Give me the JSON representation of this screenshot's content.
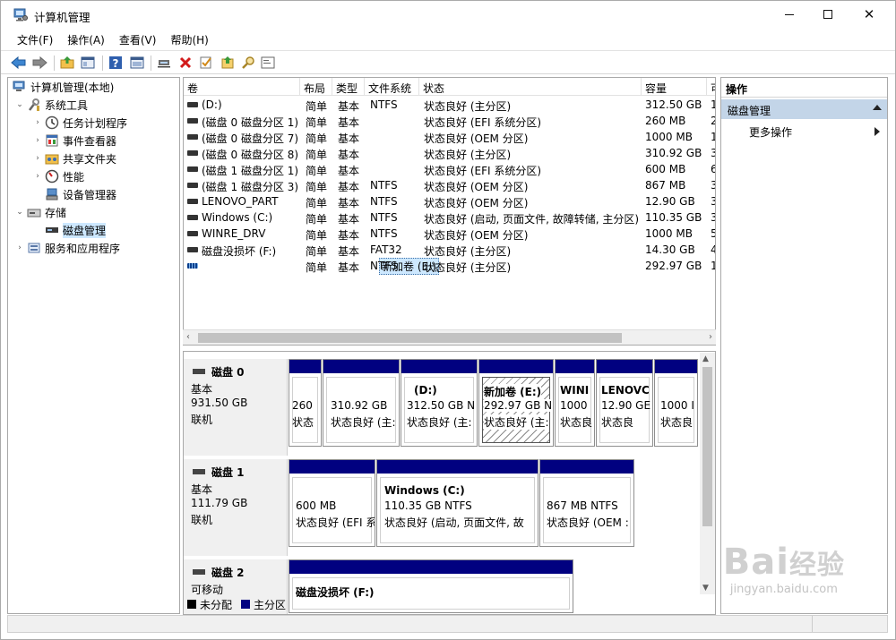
{
  "window": {
    "title": "计算机管理",
    "controls": {
      "min": "—",
      "max": "☐",
      "close": "✕"
    }
  },
  "menu": [
    "文件(F)",
    "操作(A)",
    "查看(V)",
    "帮助(H)"
  ],
  "toolbar": [
    "back-icon",
    "forward-icon",
    "up-folder-icon",
    "show-tree-icon",
    "help-icon",
    "properties-icon",
    "connect-icon",
    "delete-icon",
    "check-icon",
    "export-icon",
    "search-icon",
    "console-icon"
  ],
  "tree": {
    "root": "计算机管理(本地)",
    "items": [
      {
        "label": "系统工具",
        "level": 1,
        "expanded": true,
        "icon": "tools-icon"
      },
      {
        "label": "任务计划程序",
        "level": 2,
        "icon": "clock-icon"
      },
      {
        "label": "事件查看器",
        "level": 2,
        "icon": "event-icon"
      },
      {
        "label": "共享文件夹",
        "level": 2,
        "icon": "shared-folder-icon"
      },
      {
        "label": "性能",
        "level": 2,
        "icon": "performance-icon"
      },
      {
        "label": "设备管理器",
        "level": 2,
        "icon": "device-manager-icon"
      },
      {
        "label": "存储",
        "level": 1,
        "expanded": true,
        "icon": "storage-icon"
      },
      {
        "label": "磁盘管理",
        "level": 2,
        "icon": "disk-icon",
        "selected": true
      },
      {
        "label": "服务和应用程序",
        "level": 1,
        "expanded": false,
        "icon": "services-icon"
      }
    ]
  },
  "volumes": {
    "headers": [
      "卷",
      "布局",
      "类型",
      "文件系统",
      "状态",
      "容量",
      "可"
    ],
    "rows": [
      [
        "(D:)",
        "简单",
        "基本",
        "NTFS",
        "状态良好 (主分区)",
        "312.50 GB",
        "1"
      ],
      [
        "(磁盘 0 磁盘分区 1)",
        "简单",
        "基本",
        "",
        "状态良好 (EFI 系统分区)",
        "260 MB",
        "2"
      ],
      [
        "(磁盘 0 磁盘分区 7)",
        "简单",
        "基本",
        "",
        "状态良好 (OEM 分区)",
        "1000 MB",
        "1"
      ],
      [
        "(磁盘 0 磁盘分区 8)",
        "简单",
        "基本",
        "",
        "状态良好 (主分区)",
        "310.92 GB",
        "3"
      ],
      [
        "(磁盘 1 磁盘分区 1)",
        "简单",
        "基本",
        "",
        "状态良好 (EFI 系统分区)",
        "600 MB",
        "6"
      ],
      [
        "(磁盘 1 磁盘分区 3)",
        "简单",
        "基本",
        "NTFS",
        "状态良好 (OEM 分区)",
        "867 MB",
        "3"
      ],
      [
        "LENOVO_PART",
        "简单",
        "基本",
        "NTFS",
        "状态良好 (OEM 分区)",
        "12.90 GB",
        "3"
      ],
      [
        "Windows (C:)",
        "简单",
        "基本",
        "NTFS",
        "状态良好 (启动, 页面文件, 故障转储, 主分区)",
        "110.35 GB",
        "3"
      ],
      [
        "WINRE_DRV",
        "简单",
        "基本",
        "NTFS",
        "状态良好 (OEM 分区)",
        "1000 MB",
        "5"
      ],
      [
        "磁盘没损坏 (F:)",
        "简单",
        "基本",
        "FAT32",
        "状态良好 (主分区)",
        "14.30 GB",
        "4"
      ],
      [
        "新加卷 (E:)",
        "简单",
        "基本",
        "NTFS",
        "状态良好 (主分区)",
        "292.97 GB",
        "1"
      ]
    ]
  },
  "disks": [
    {
      "name": "磁盘 0",
      "type": "基本",
      "size": "931.50 GB",
      "status": "联机",
      "parts": [
        {
          "l1": "",
          "l2": "260",
          "l3": "状态"
        },
        {
          "l1": "",
          "l2": "310.92 GB",
          "l3": "状态良好 (主:"
        },
        {
          "l1": "(D:)",
          "l2": "312.50 GB N",
          "l3": "状态良好 (主:"
        },
        {
          "l1": "新加卷 (E:)",
          "l2": "292.97 GB N",
          "l3": "状态良好 (主:"
        },
        {
          "l1": "WINI",
          "l2": "1000",
          "l3": "状态良"
        },
        {
          "l1": "LENOVC",
          "l2": "12.90 GE",
          "l3": "状态良"
        },
        {
          "l1": "",
          "l2": "1000 I",
          "l3": "状态良"
        }
      ]
    },
    {
      "name": "磁盘 1",
      "type": "基本",
      "size": "111.79 GB",
      "status": "联机",
      "parts": [
        {
          "l1": "",
          "l2": "600 MB",
          "l3": "状态良好 (EFI 系"
        },
        {
          "l1": "Windows  (C:)",
          "l2": "110.35 GB NTFS",
          "l3": "状态良好 (启动, 页面文件, 故"
        },
        {
          "l1": "",
          "l2": "867 MB NTFS",
          "l3": "状态良好 (OEM :"
        }
      ]
    },
    {
      "name": "磁盘 2",
      "type": "可移动",
      "size": "",
      "status": "",
      "parts": [
        {
          "l1": "磁盘没损坏  (F:)",
          "l2": "",
          "l3": ""
        }
      ]
    }
  ],
  "legend": [
    {
      "label": "未分配",
      "color": "#000000"
    },
    {
      "label": "主分区",
      "color": "#010180"
    }
  ],
  "actions": {
    "header": "操作",
    "section": "磁盘管理",
    "item": "更多操作"
  },
  "watermark": {
    "big": "Bai",
    "cn": "经验",
    "small": "jingyan.baidu.com"
  },
  "left_edge_char": "文"
}
